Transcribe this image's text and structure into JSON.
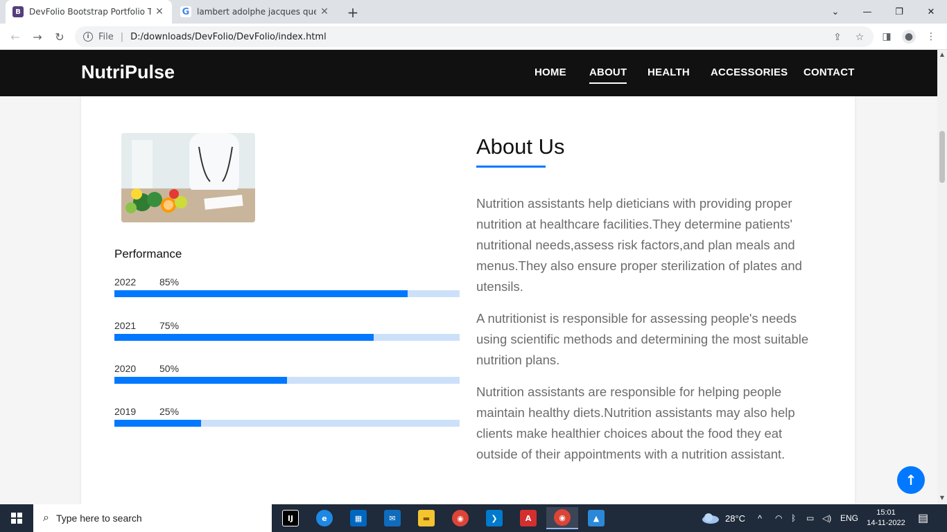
{
  "browser": {
    "tabs": [
      {
        "icon": "bootstrap-icon",
        "title": "DevFolio Bootstrap Portfolio Tem",
        "fav_text": "B"
      },
      {
        "icon": "google-icon",
        "title": "lambert adolphe jacques quetele",
        "fav_text": "G"
      }
    ],
    "new_tab": "+",
    "controls": {
      "dropdown": "⌄",
      "minimize": "—",
      "restore": "❐",
      "close": "✕"
    },
    "nav": {
      "back": "←",
      "forward": "→",
      "reload": "↻"
    },
    "address": {
      "info_glyph": "i",
      "scheme_label": "File",
      "url": "D:/downloads/DevFolio/DevFolio/index.html"
    },
    "right_icons": {
      "share": "⇪",
      "bookmark": "☆",
      "sidepanel": "◨",
      "profile": "●",
      "menu": "⋮"
    }
  },
  "site": {
    "brand": "NutriPulse",
    "menu": [
      {
        "label": "HOME"
      },
      {
        "label": "ABOUT",
        "active": true
      },
      {
        "label": "HEALTH"
      },
      {
        "label": "ACCESSORIES"
      },
      {
        "label": "CONTACT"
      }
    ],
    "performance": {
      "title": "Performance",
      "bars": [
        {
          "year": "2022",
          "percent_label": "85%",
          "value": 0.85
        },
        {
          "year": "2021",
          "percent_label": "75%",
          "value": 0.75
        },
        {
          "year": "2020",
          "percent_label": "50%",
          "value": 0.5
        },
        {
          "year": "2019",
          "percent_label": "25%",
          "value": 0.25
        }
      ]
    },
    "about": {
      "title": "About Us",
      "paragraphs": [
        "Nutrition assistants help dieticians with providing proper nutrition at healthcare facilities.They determine patients' nutritional needs,assess risk factors,and plan meals and menus.They also ensure proper sterilization of plates and utensils.",
        "A nutritionist is responsible for assessing people's needs using scientific methods and determining the most suitable nutrition plans.",
        "Nutrition assistants are responsible for helping people maintain healthy diets.Nutrition assistants may also help clients make healthier choices about the food they eat outside of their appointments with a nutrition assistant."
      ]
    },
    "back_to_top": "↑",
    "accent_color": "#0078ff"
  },
  "taskbar": {
    "search_placeholder": "Type here to search",
    "search_glyph": "⌕",
    "apps": [
      {
        "name": "intellij-icon",
        "glyph": "IJ",
        "color": "#000000"
      },
      {
        "name": "edge-icon",
        "glyph": "e",
        "color": "#1e88e5"
      },
      {
        "name": "store-icon",
        "glyph": "▦",
        "color": "#0067c0"
      },
      {
        "name": "mail-icon",
        "glyph": "✉",
        "color": "#0f6cbd"
      },
      {
        "name": "file-explorer-icon",
        "glyph": "▬",
        "color": "#f4c430"
      },
      {
        "name": "chrome-icon",
        "glyph": "◉",
        "color": "#db4437"
      },
      {
        "name": "vscode-icon",
        "glyph": "❯",
        "color": "#007acc"
      },
      {
        "name": "acrobat-icon",
        "glyph": "A",
        "color": "#d32f2f"
      },
      {
        "name": "chrome-active-icon",
        "glyph": "◉",
        "color": "#db4437",
        "active": true
      },
      {
        "name": "photos-icon",
        "glyph": "▲",
        "color": "#2b88d8"
      }
    ],
    "weather": {
      "temp": "28°C"
    },
    "tray_glyphs": {
      "chevron": "^",
      "wifi": "◠",
      "bluetooth": "ᛒ",
      "battery": "▭",
      "volume": "◁)"
    },
    "language": "ENG",
    "time": "15:01",
    "date": "14-11-2022",
    "notification": "▤"
  }
}
